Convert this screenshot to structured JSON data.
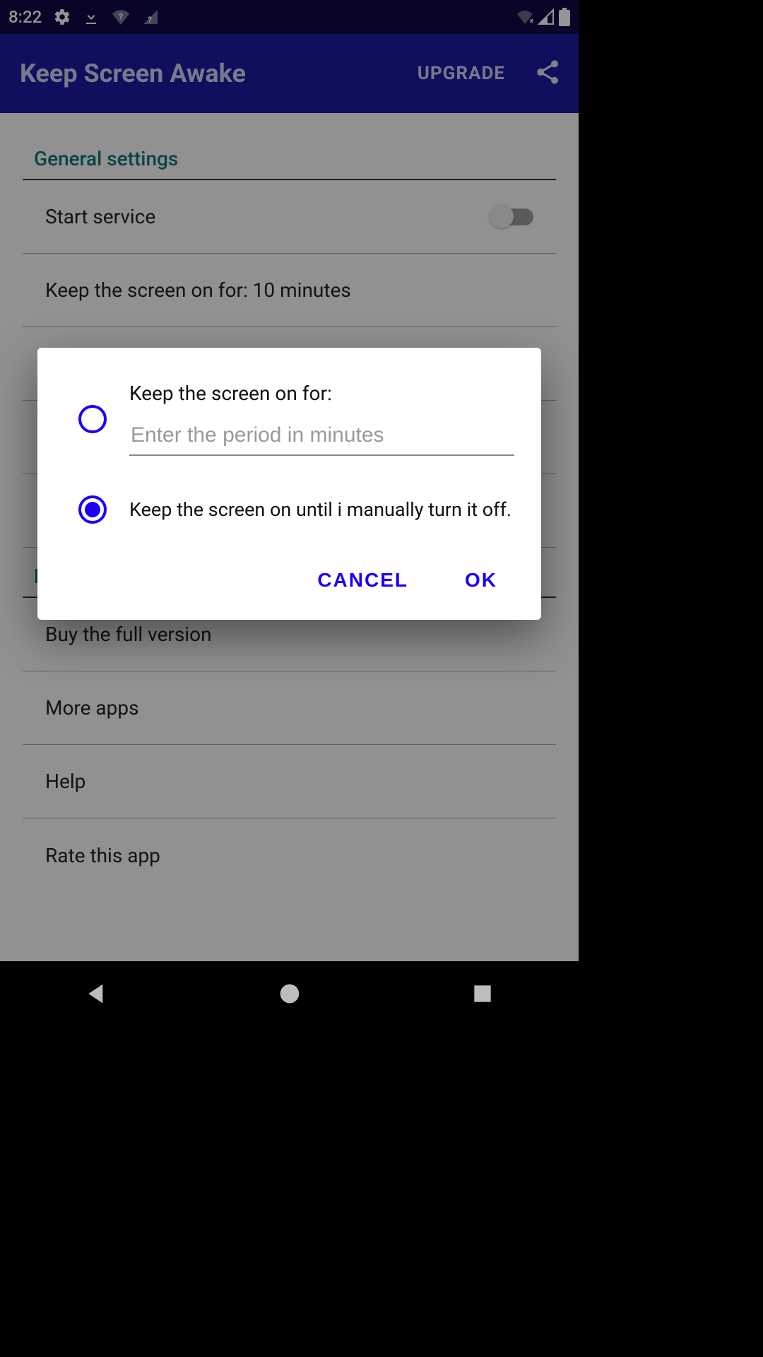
{
  "status": {
    "time": "8:22"
  },
  "appbar": {
    "title": "Keep Screen Awake",
    "upgrade": "UPGRADE"
  },
  "sections": {
    "general": "General settings",
    "more": "More"
  },
  "settings": {
    "start_service": "Start service",
    "keep_on_for": "Keep the screen on for: 10 minutes",
    "buy_full": "Buy the full version",
    "more_apps": "More apps",
    "help": "Help",
    "rate": "Rate this app"
  },
  "dialog": {
    "title_label": "Keep the screen on for:",
    "input_placeholder": "Enter the period in minutes",
    "option_manual": "Keep the screen on until i manually turn it off.",
    "btn_cancel": "CANCEL",
    "btn_ok": "OK"
  }
}
